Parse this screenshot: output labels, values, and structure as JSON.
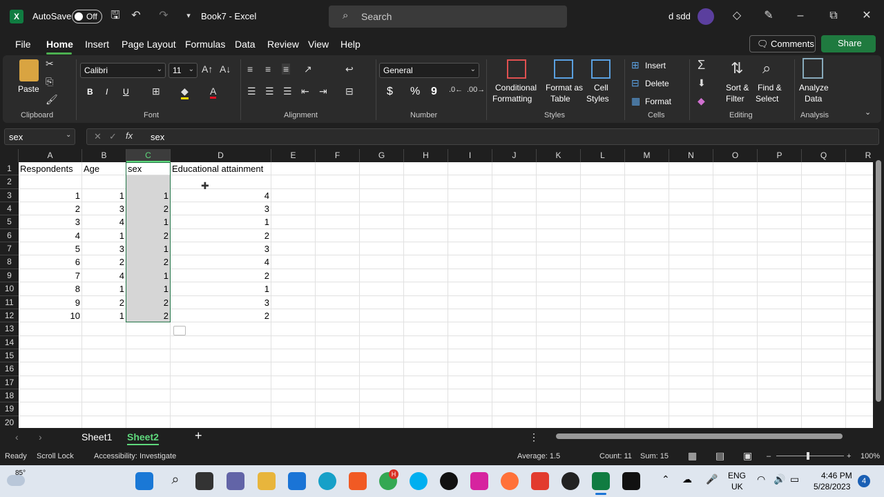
{
  "titlebar": {
    "app_logo": "X",
    "autosave_label": "AutoSave",
    "autosave_state": "Off",
    "doc_title": "Book7  -  Excel",
    "search_placeholder": "Search",
    "user_name": "d sdd"
  },
  "menu": {
    "items": [
      "File",
      "Home",
      "Insert",
      "Page Layout",
      "Formulas",
      "Data",
      "Review",
      "View",
      "Help"
    ],
    "active": "Home",
    "comments_label": "Comments",
    "share_label": "Share"
  },
  "ribbon": {
    "clipboard": {
      "paste": "Paste",
      "label": "Clipboard"
    },
    "font": {
      "name": "Calibri",
      "size": "11",
      "label": "Font",
      "bold": "B",
      "italic": "I",
      "underline": "U"
    },
    "alignment": {
      "label": "Alignment"
    },
    "number": {
      "format": "General",
      "label": "Number",
      "currency": "$",
      "percent": "%",
      "comma": "9"
    },
    "styles": {
      "conditional_1": "Conditional",
      "conditional_2": "Formatting",
      "format_table_1": "Format as",
      "format_table_2": "Table",
      "cell_styles_1": "Cell",
      "cell_styles_2": "Styles",
      "label": "Styles"
    },
    "cells": {
      "insert": "Insert",
      "delete": "Delete",
      "format": "Format",
      "label": "Cells"
    },
    "editing": {
      "sort_1": "Sort &",
      "sort_2": "Filter",
      "find_1": "Find &",
      "find_2": "Select",
      "label": "Editing"
    },
    "analysis": {
      "analyze_1": "Analyze",
      "analyze_2": "Data",
      "label": "Analysis"
    }
  },
  "formula_bar": {
    "name_box": "sex",
    "fx": "fx",
    "content": "sex"
  },
  "grid": {
    "columns": [
      "A",
      "B",
      "C",
      "D",
      "E",
      "F",
      "G",
      "H",
      "I",
      "J",
      "K",
      "L",
      "M",
      "N",
      "O",
      "P",
      "Q",
      "R"
    ],
    "selected_column": "C",
    "rows": [
      "1",
      "2",
      "3",
      "4",
      "5",
      "6",
      "7",
      "8",
      "9",
      "10",
      "11",
      "12",
      "13",
      "14",
      "15",
      "16",
      "17",
      "18",
      "19",
      "20"
    ],
    "headers": {
      "A": "Respondents",
      "B": "Age",
      "C": "sex",
      "D": "Educational attainment"
    },
    "data": [
      [
        "1",
        "1",
        "1",
        "4"
      ],
      [
        "2",
        "3",
        "2",
        "3"
      ],
      [
        "3",
        "4",
        "1",
        "1"
      ],
      [
        "4",
        "1",
        "2",
        "2"
      ],
      [
        "5",
        "3",
        "1",
        "3"
      ],
      [
        "6",
        "2",
        "2",
        "4"
      ],
      [
        "7",
        "4",
        "1",
        "2"
      ],
      [
        "8",
        "1",
        "1",
        "1"
      ],
      [
        "9",
        "2",
        "2",
        "3"
      ],
      [
        "10",
        "1",
        "2",
        "2"
      ]
    ]
  },
  "sheets": {
    "tabs": [
      "Sheet1",
      "Sheet2"
    ],
    "active": "Sheet2",
    "add": "+"
  },
  "status": {
    "ready": "Ready",
    "scroll_lock": "Scroll Lock",
    "accessibility": "Accessibility: Investigate",
    "average": "Average: 1.5",
    "count": "Count: 11",
    "sum": "Sum: 15",
    "zoom": "100%"
  },
  "taskbar": {
    "weather": "85°",
    "lang_1": "ENG",
    "lang_2": "UK",
    "time": "4:46 PM",
    "date": "5/28/2023",
    "notifications": "4",
    "chrome_badge": "H"
  }
}
